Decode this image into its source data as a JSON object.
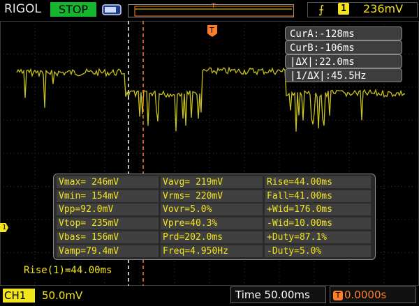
{
  "header": {
    "brand": "RIGOL",
    "run_state": "STOP",
    "trigger": {
      "channel": "1",
      "level": "236mV",
      "edge_icon": "rising-edge-icon"
    }
  },
  "colors": {
    "ch1": "#f2e41d",
    "trigger": "#ff7f27",
    "cursor_a": "#ffffff",
    "stop": "#16b52e"
  },
  "cursors": {
    "cur_a": "CurA:-128ms",
    "cur_b": "CurB:-106ms",
    "delta_x": "|ΔX|:22.0ms",
    "inv_delta_x": "|1/ΔX|:45.5Hz"
  },
  "measurements": [
    [
      "Vmax= 246mV",
      "Vavg= 219mV",
      "Rise=44.00ms"
    ],
    [
      "Vmin= 154mV",
      "Vrms= 220mV",
      "Fall=41.00ms"
    ],
    [
      "Vpp=92.0mV",
      "Vovr=5.0%",
      "+Wid=176.0ms"
    ],
    [
      "Vtop= 235mV",
      "Vpre=40.3%",
      "-Wid=10.00ms"
    ],
    [
      "Vbas= 156mV",
      "Prd=202.0ms",
      "+Duty=87.1%"
    ],
    [
      "Vamp=79.4mV",
      "Freq=4.950Hz",
      "-Duty=5.0%"
    ]
  ],
  "rise_label": "Rise(1)=44.00ms",
  "footer": {
    "ch1_label": "CH1",
    "ch1_scale": "50.0mV",
    "timebase": "Time 50.00ms",
    "trigger_position": "0.0000s"
  },
  "markers": {
    "channel": "1",
    "trigger": "T"
  }
}
